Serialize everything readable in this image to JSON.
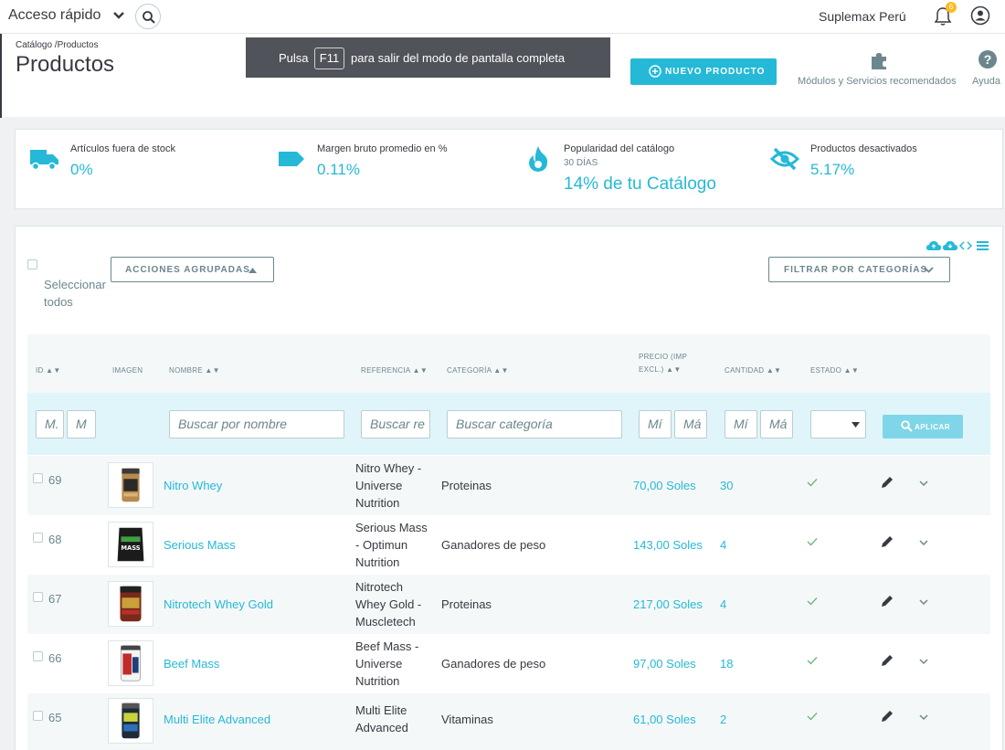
{
  "topbar": {
    "quick_access": "Acceso rápido",
    "shop_name": "Suplemax Perú",
    "notification_count": "6"
  },
  "header": {
    "breadcrumb": "Catálogo /Productos",
    "title": "Productos",
    "fullscreen_prefix": "Pulsa",
    "fullscreen_key": "F11",
    "fullscreen_suffix": "para salir del modo de pantalla completa",
    "new_product": "NUEVO PRODUCTO",
    "modules_label": "Módulos y Servicios recomendados",
    "help_label": "Ayuda"
  },
  "kpis": {
    "out_of_stock": {
      "label": "Artículos fuera de stock",
      "value": "0%"
    },
    "margin": {
      "label": "Margen bruto promedio en %",
      "value": "0.11%"
    },
    "popularity": {
      "label": "Popularidad del catálogo",
      "sub": "30 DÍAS",
      "value": "14% de tu Catálogo"
    },
    "disabled": {
      "label": "Productos desactivados",
      "value": "5.17%"
    }
  },
  "list": {
    "select_all": "Seleccionar todos",
    "bulk_actions": "ACCIONES AGRUPADAS",
    "filter_by_category": "FILTRAR POR CATEGORÍAS",
    "apply": "APLICAR",
    "columns": {
      "id": "ID ▲▼",
      "image": "IMAGEN",
      "name": "NOMBRE ▲▼",
      "reference": "REFERENCIA ▲▼",
      "category": "CATEGORÍA ▲▼",
      "price_line1": "PRECIO (IMP",
      "price_line2": "EXCL.) ▲▼",
      "quantity": "CANTIDAD ▲▼",
      "status": "ESTADO ▲▼"
    },
    "filters": {
      "id_min": "M.",
      "id_max": "M",
      "name": "Buscar por nombre",
      "reference": "Buscar re",
      "category": "Buscar categoría",
      "price_min": "Mí",
      "price_max": "Má",
      "qty_min": "Mí",
      "qty_max": "Má"
    },
    "rows": [
      {
        "id": "69",
        "name": "Nitro Whey",
        "ref1": "Nitro Whey -",
        "ref2": "Universe",
        "ref3": "Nutrition",
        "category": "Proteinas",
        "price": "70,00 Soles",
        "qty": "30"
      },
      {
        "id": "68",
        "name": "Serious Mass",
        "ref1": "Serious Mass",
        "ref2": "- Optimun",
        "ref3": "Nutrition",
        "category": "Ganadores de peso",
        "price": "143,00 Soles",
        "qty": "4"
      },
      {
        "id": "67",
        "name": "Nitrotech Whey Gold",
        "ref1": "Nitrotech",
        "ref2": "Whey Gold -",
        "ref3": "Muscletech",
        "category": "Proteinas",
        "price": "217,00 Soles",
        "qty": "4"
      },
      {
        "id": "66",
        "name": "Beef Mass",
        "ref1": "Beef Mass -",
        "ref2": "Universe",
        "ref3": "Nutrition",
        "category": "Ganadores de peso",
        "price": "97,00 Soles",
        "qty": "18"
      },
      {
        "id": "65",
        "name": "Multi Elite Advanced",
        "ref1": "Multi Elite",
        "ref2": "Advanced",
        "ref3": "",
        "category": "Vitaminas",
        "price": "61,00 Soles",
        "qty": "2"
      }
    ]
  },
  "colors": {
    "accent": "#25b9d7",
    "text": "#363a41",
    "muted": "#6c868e",
    "success": "#70b580"
  }
}
